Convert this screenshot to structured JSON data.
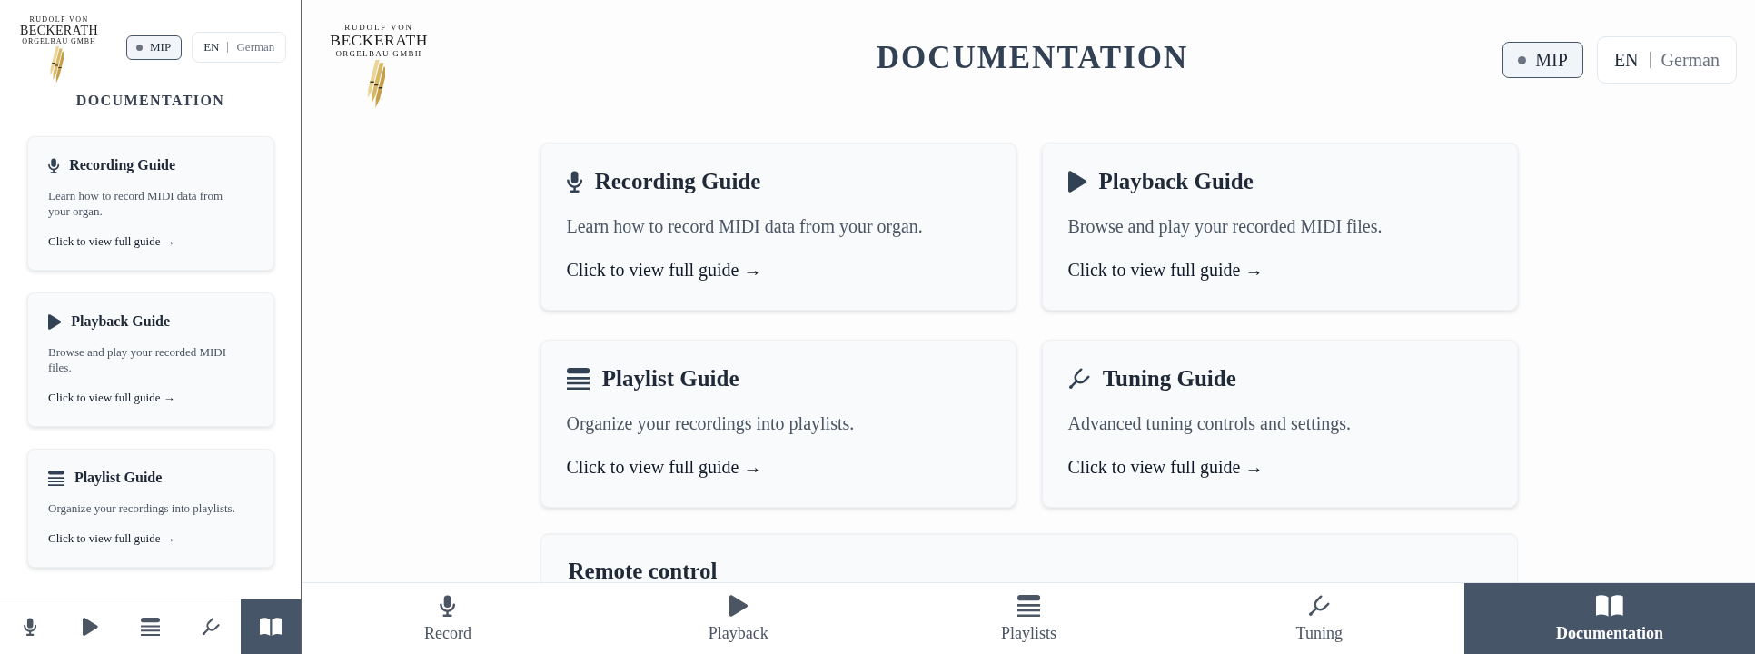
{
  "sidebar": {
    "logo": {
      "tagline": "RUDOLF VON",
      "wordmark": "BECKERATH",
      "subtitle": "ORGELBAU GMBH"
    },
    "mip_button": {
      "label": "MIP"
    },
    "languages": [
      {
        "label": "EN",
        "selected": true
      },
      {
        "label": "German",
        "selected": false
      }
    ],
    "heading": "DOCUMENTATION",
    "guides": [
      {
        "kind": "record",
        "title": "Recording Guide",
        "description": "Learn how to record MIDI data from your organ.",
        "link": "Click to view full guide →"
      },
      {
        "kind": "playback",
        "title": "Playback Guide",
        "description": "Browse and play your recorded MIDI files.",
        "link": "Click to view full guide →"
      },
      {
        "kind": "playlists",
        "title": "Playlist Guide",
        "description": "Organize your recordings into playlists.",
        "link": "Click to view full guide →"
      }
    ],
    "nav": [
      {
        "kind": "record",
        "selected": false
      },
      {
        "kind": "playback",
        "selected": false
      },
      {
        "kind": "playlists",
        "selected": false
      },
      {
        "kind": "tuning",
        "selected": false
      },
      {
        "kind": "documentation",
        "selected": true
      }
    ]
  },
  "main": {
    "logo": {
      "tagline": "RUDOLF VON",
      "wordmark": "BECKERATH",
      "subtitle": "ORGELBAU GMBH"
    },
    "heading": "DOCUMENTATION",
    "mip_button": {
      "label": "MIP"
    },
    "languages": [
      {
        "label": "EN",
        "selected": true
      },
      {
        "label": "German",
        "selected": false
      }
    ],
    "guides": [
      {
        "kind": "record",
        "title": "Recording Guide",
        "description": "Learn how to record MIDI data from your organ.",
        "link": "Click to view full guide →"
      },
      {
        "kind": "playback",
        "title": "Playback Guide",
        "description": "Browse and play your recorded MIDI files.",
        "link": "Click to view full guide →"
      },
      {
        "kind": "playlists",
        "title": "Playlist Guide",
        "description": "Organize your recordings into playlists.",
        "link": "Click to view full guide →"
      },
      {
        "kind": "tuning",
        "title": "Tuning Guide",
        "description": "Advanced tuning controls and settings.",
        "link": "Click to view full guide →"
      }
    ],
    "remote_control": {
      "title": "Remote control"
    },
    "nav": [
      {
        "kind": "record",
        "label": "Record",
        "selected": false
      },
      {
        "kind": "playback",
        "label": "Playback",
        "selected": false
      },
      {
        "kind": "playlists",
        "label": "Playlists",
        "selected": false
      },
      {
        "kind": "tuning",
        "label": "Tuning",
        "selected": false
      },
      {
        "kind": "documentation",
        "label": "Documentation",
        "selected": true
      }
    ]
  }
}
